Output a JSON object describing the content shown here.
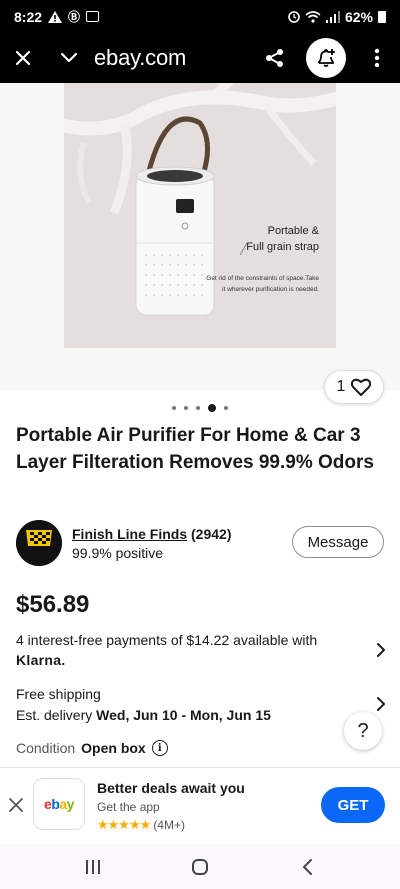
{
  "status_bar": {
    "time": "8:22",
    "battery": "62%"
  },
  "browser": {
    "url": "ebay.com"
  },
  "hero": {
    "image_heading": "Portable &\nFull grain strap",
    "image_caption": "Get rid of the constraints of space.Take it wherever purification is needed.",
    "like_count": "1",
    "carousel_dots": 5,
    "active_dot": 3
  },
  "listing": {
    "title": "Portable Air Purifier For Home & Car 3 Layer Filteration Removes 99.9% Odors",
    "price": "$56.89",
    "klarna_text": "4 interest-free payments of $14.22 available with",
    "klarna_brand": "Klarna.",
    "shipping": "Free shipping",
    "delivery_label": "Est. delivery ",
    "delivery_dates": "Wed, Jun 10 - Mon, Jun 15",
    "condition_label": "Condition",
    "condition_value": "Open box"
  },
  "seller": {
    "name": "Finish Line Finds",
    "feedback_count": "(2942)",
    "positive": "99.9% positive",
    "message_label": "Message",
    "logo_text": "FINISH LINE FINDS"
  },
  "app_banner": {
    "title": "Better deals await you",
    "subtitle": "Get the app",
    "rating_count": "(4M+)",
    "stars": "★★★★★",
    "get_label": "GET",
    "logo_text": "ebay"
  },
  "colors": {
    "accent": "#0968f6",
    "star": "#f5af02",
    "ebay_e": "#e53238",
    "ebay_b": "#0064d2",
    "ebay_a": "#f5af02",
    "ebay_y": "#86b817"
  }
}
